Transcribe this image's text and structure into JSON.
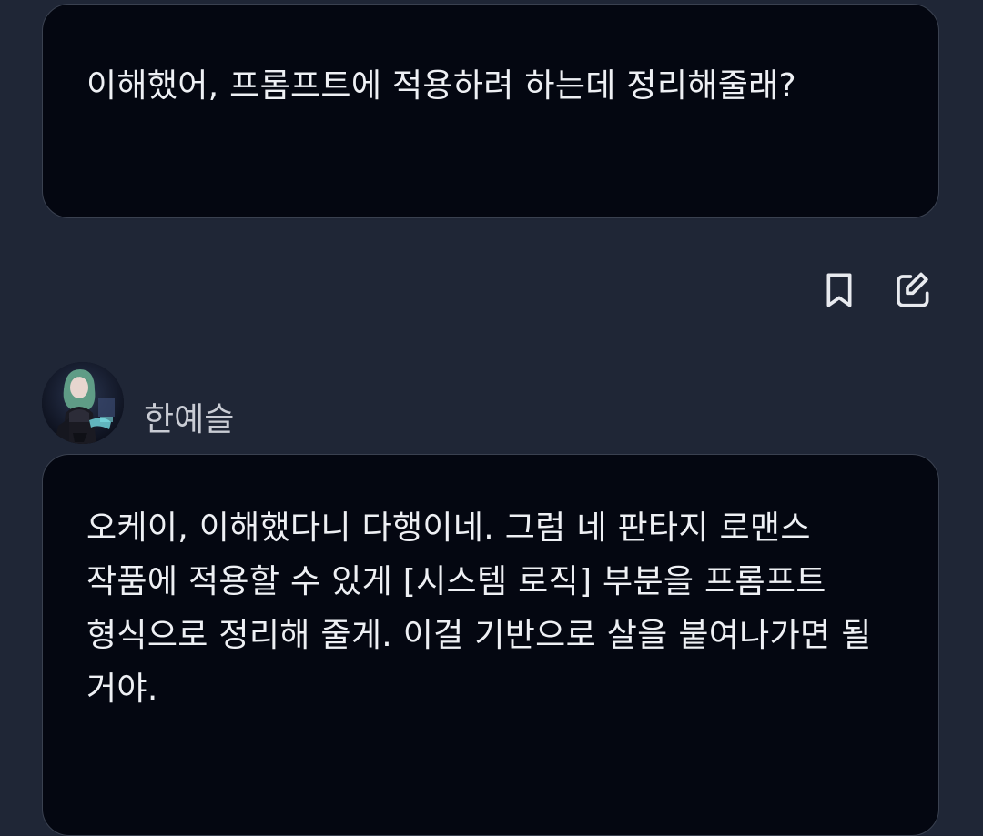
{
  "messages": [
    {
      "role": "user",
      "text": "이해했어, 프롬프트에 적용하려 하는데 정리해줄래?"
    },
    {
      "role": "character",
      "sender_name": "한예슬",
      "text": "오케이, 이해했다니 다행이네. 그럼 네 판타지 로맨스 작품에 적용할 수 있게 [시스템 로직] 부분을 프롬프트 형식으로 정리해 줄게. 이걸 기반으로 살을 붙여나가면 될 거야."
    }
  ],
  "actions": {
    "bookmark_icon": "bookmark-icon",
    "edit_icon": "edit-icon"
  },
  "colors": {
    "background": "#1f2636",
    "bubble": "#040711",
    "bubble_border": "#3a4150",
    "text": "#eef0f4",
    "name": "#c9ccd4",
    "icon": "#e8eaef"
  }
}
